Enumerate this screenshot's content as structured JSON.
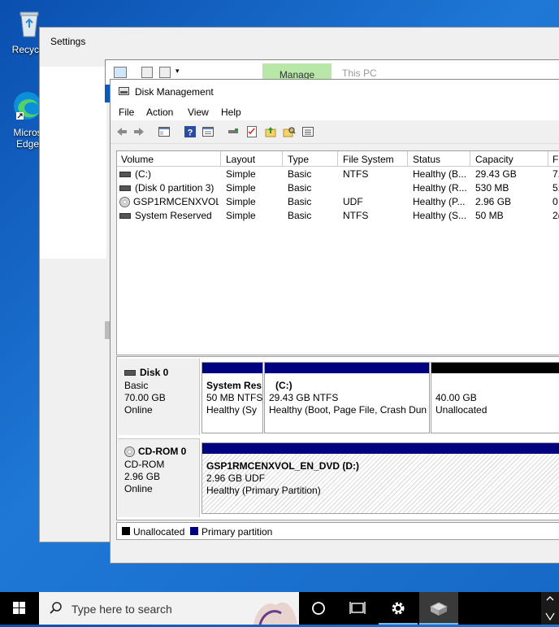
{
  "desktop": {
    "recycle_bin": "Recycle",
    "edge_line1": "Micros",
    "edge_line2": "Edge"
  },
  "settings": {
    "title": "Settings"
  },
  "explorer": {
    "manage_tab": "Manage",
    "location": "This PC"
  },
  "disk_management": {
    "title": "Disk Management",
    "menu": [
      "File",
      "Action",
      "View",
      "Help"
    ],
    "columns": [
      "Volume",
      "Layout",
      "Type",
      "File System",
      "Status",
      "Capacity",
      "F"
    ],
    "volumes": [
      {
        "name": "(C:)",
        "layout": "Simple",
        "type": "Basic",
        "fs": "NTFS",
        "status": "Healthy (B...",
        "capacity": "29.43 GB",
        "free": "7.",
        "icon": "drive-icon"
      },
      {
        "name": "(Disk 0 partition 3)",
        "layout": "Simple",
        "type": "Basic",
        "fs": "",
        "status": "Healthy (R...",
        "capacity": "530 MB",
        "free": "5:",
        "icon": "drive-icon"
      },
      {
        "name": "GSP1RMCENXVOL...",
        "layout": "Simple",
        "type": "Basic",
        "fs": "UDF",
        "status": "Healthy (P...",
        "capacity": "2.96 GB",
        "free": "0",
        "icon": "cd-icon"
      },
      {
        "name": "System Reserved",
        "layout": "Simple",
        "type": "Basic",
        "fs": "NTFS",
        "status": "Healthy (S...",
        "capacity": "50 MB",
        "free": "2(",
        "icon": "drive-icon"
      }
    ],
    "disks": [
      {
        "name": "Disk 0",
        "kind": "Basic",
        "size": "70.00 GB",
        "state": "Online",
        "partitions": [
          {
            "line1": "System Res",
            "line2": "50 MB NTFS",
            "line3": "Healthy (Sy",
            "bar": "#000080"
          },
          {
            "line1": "(C:)",
            "line2": "29.43 GB NTFS",
            "line3": "Healthy (Boot, Page File, Crash Dun",
            "bar": "#000080"
          },
          {
            "line1": "",
            "line2": "40.00 GB",
            "line3": "Unallocated",
            "bar": "#000000"
          }
        ]
      },
      {
        "name": "CD-ROM 0",
        "kind": "CD-ROM",
        "size": "2.96 GB",
        "state": "Online",
        "partitions": [
          {
            "line1": "GSP1RMCENXVOL_EN_DVD  (D:)",
            "line2": "2.96 GB UDF",
            "line3": "Healthy (Primary Partition)",
            "bar": "#000080"
          }
        ]
      }
    ],
    "legend": [
      {
        "label": "Unallocated",
        "color": "#000000"
      },
      {
        "label": "Primary partition",
        "color": "#000080"
      }
    ]
  },
  "taskbar": {
    "search_placeholder": "Type here to search"
  }
}
